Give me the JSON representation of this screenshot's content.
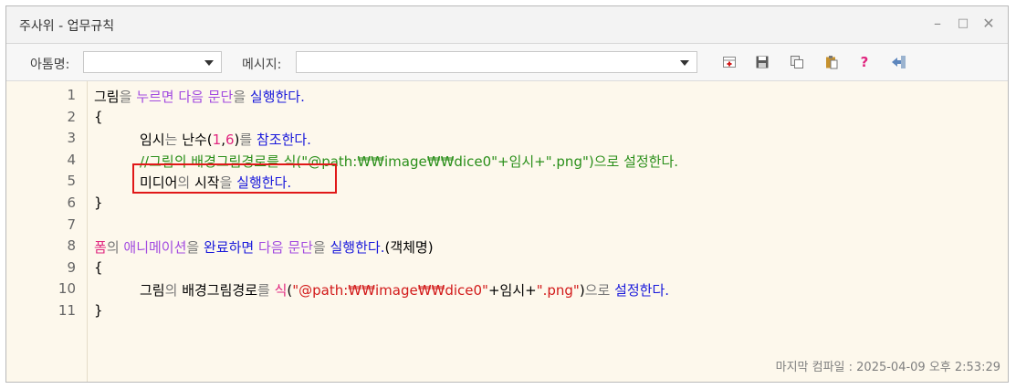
{
  "window": {
    "title": "주사위 - 업무규칙",
    "controls": {
      "minimize": "–",
      "maximize": "□",
      "close": "✕"
    }
  },
  "toolbar": {
    "name_label": "아톰명:",
    "name_value": "",
    "message_label": "메시지:",
    "message_value": "",
    "icons": [
      "add-icon",
      "save-icon",
      "copy-icon",
      "paste-icon",
      "help-icon",
      "exit-icon"
    ],
    "help_glyph": "?"
  },
  "editor": {
    "line_numbers": [
      "1",
      "2",
      "3",
      "4",
      "5",
      "6",
      "7",
      "8",
      "9",
      "10",
      "11"
    ],
    "lines": [
      [
        {
          "t": "그림",
          "c": "black"
        },
        {
          "t": "을 ",
          "c": "gray"
        },
        {
          "t": "누르면 ",
          "c": "purple"
        },
        {
          "t": "다음 문단",
          "c": "purple"
        },
        {
          "t": "을 ",
          "c": "gray"
        },
        {
          "t": "실행한다.",
          "c": "blue"
        }
      ],
      [
        {
          "t": "{",
          "c": "black"
        }
      ],
      [
        {
          "t": "임시",
          "c": "black"
        },
        {
          "t": "는 ",
          "c": "gray"
        },
        {
          "t": "난수",
          "c": "black"
        },
        {
          "t": "(",
          "c": "black"
        },
        {
          "t": "1",
          "c": "pink"
        },
        {
          "t": ",",
          "c": "black"
        },
        {
          "t": "6",
          "c": "pink"
        },
        {
          "t": ")",
          "c": "black"
        },
        {
          "t": "를 ",
          "c": "gray"
        },
        {
          "t": "참조한다.",
          "c": "blue"
        }
      ],
      [
        {
          "t": "//그림의 배경그림경로를 식(\"@path:₩₩image₩₩dice0\"+임시+\".png\")으로 설정한다.",
          "c": "green"
        }
      ],
      [
        {
          "t": "미디어",
          "c": "black"
        },
        {
          "t": "의 ",
          "c": "gray"
        },
        {
          "t": "시작",
          "c": "black"
        },
        {
          "t": "을 ",
          "c": "gray"
        },
        {
          "t": "실행한다.",
          "c": "blue"
        }
      ],
      [
        {
          "t": "}",
          "c": "black"
        }
      ],
      [],
      [
        {
          "t": "폼",
          "c": "pink"
        },
        {
          "t": "의 ",
          "c": "gray"
        },
        {
          "t": "애니메이션",
          "c": "purple"
        },
        {
          "t": "을 ",
          "c": "gray"
        },
        {
          "t": "완료하면 ",
          "c": "blue"
        },
        {
          "t": "다음 문단",
          "c": "purple"
        },
        {
          "t": "을 ",
          "c": "gray"
        },
        {
          "t": "실행한다.",
          "c": "blue"
        },
        {
          "t": "(객체명)",
          "c": "black"
        }
      ],
      [
        {
          "t": "{",
          "c": "black"
        }
      ],
      [
        {
          "t": "그림",
          "c": "black"
        },
        {
          "t": "의 ",
          "c": "gray"
        },
        {
          "t": "배경그림경로",
          "c": "black"
        },
        {
          "t": "를 ",
          "c": "gray"
        },
        {
          "t": "식",
          "c": "pink"
        },
        {
          "t": "(",
          "c": "black"
        },
        {
          "t": "\"@path:₩₩image₩₩dice0\"",
          "c": "red"
        },
        {
          "t": "+임시+",
          "c": "black"
        },
        {
          "t": "\".png\"",
          "c": "red"
        },
        {
          "t": ")",
          "c": "black"
        },
        {
          "t": "으로 ",
          "c": "gray"
        },
        {
          "t": "설정한다.",
          "c": "blue"
        }
      ],
      [
        {
          "t": "}",
          "c": "black"
        }
      ]
    ],
    "indented_lines": [
      2,
      3,
      4,
      9
    ]
  },
  "status": {
    "compile_text": "마지막 컴파일 : 2025-04-09 오후 2:53:29"
  },
  "colors": {
    "editor_bg": "#fdf8ec",
    "highlight_border": "#e01818",
    "keyword_blue": "#1a1adb",
    "keyword_purple": "#a24ae0",
    "literal_pink": "#e0267f",
    "string_red": "#d21a1a",
    "comment_green": "#2a8f1a"
  }
}
